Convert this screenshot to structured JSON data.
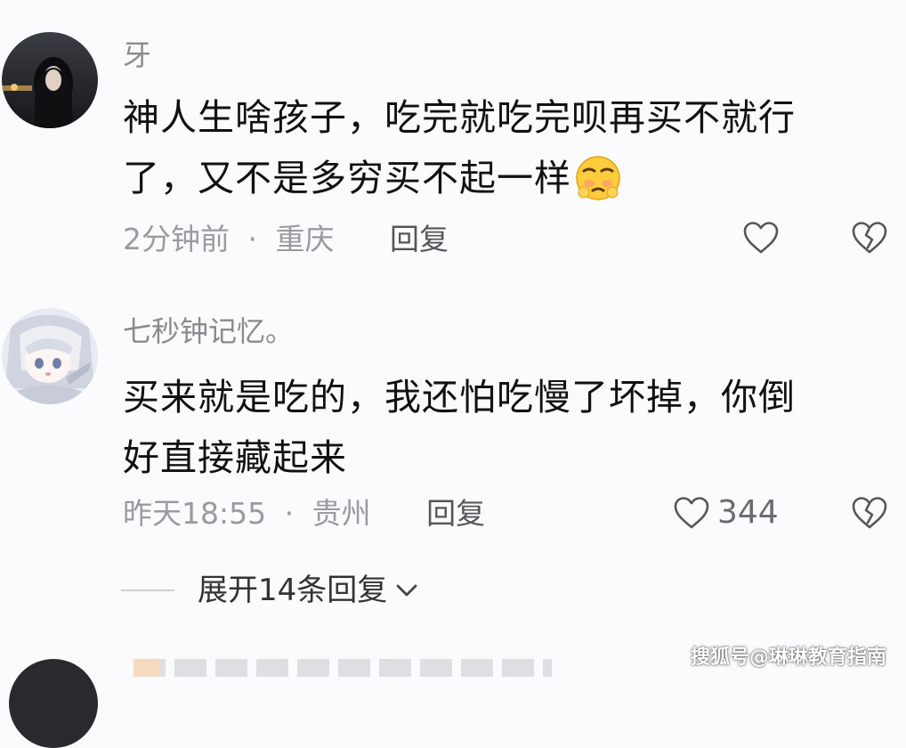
{
  "comments": [
    {
      "username": "牙",
      "content_line1": "神人生啥孩子，吃完就吃完呗再买不就行",
      "content_line2": "了，又不是多穷买不起一样",
      "time": "2分钟前",
      "location": "重庆",
      "separator": "·",
      "reply_label": "回复",
      "like_count": "",
      "emoji_icon": "smirk-face-icon"
    },
    {
      "username": "七秒钟记忆。",
      "content_line1": "买来就是吃的，我还怕吃慢了坏掉，你倒",
      "content_line2": "好直接藏起来",
      "time": "昨天18:55",
      "location": "贵州",
      "separator": "·",
      "reply_label": "回复",
      "like_count": "344"
    }
  ],
  "expand_replies": "展开14条回复",
  "watermark": "搜狐号@琳琳教育指南",
  "colors": {
    "background": "#fbfbfd",
    "username": "#8a8a8f",
    "meta": "#9a9aa0",
    "icon_stroke": "#55555a"
  }
}
